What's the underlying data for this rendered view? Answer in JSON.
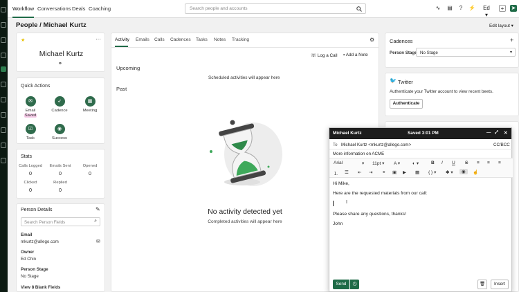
{
  "topnav": {
    "items": [
      "Workflow",
      "Conversations",
      "Deals",
      "Coaching"
    ],
    "search_placeholder": "Search people and accounts",
    "user": "Ed"
  },
  "page": {
    "breadcrumb_root": "People",
    "breadcrumb_sep": "/",
    "breadcrumb_current": "Michael Kurtz",
    "edit_layout": "Edit layout"
  },
  "profile": {
    "name": "Michael Kurtz"
  },
  "quick_actions": {
    "title": "Quick Actions",
    "items": [
      {
        "label": "Email",
        "badge": "Saved"
      },
      {
        "label": "Cadence"
      },
      {
        "label": "Meeting"
      },
      {
        "label": "Task"
      },
      {
        "label": "Success"
      }
    ]
  },
  "stats": {
    "title": "Stats",
    "items": [
      {
        "label": "Calls Logged",
        "value": "0"
      },
      {
        "label": "Emails Sent",
        "value": "0"
      },
      {
        "label": "Opened",
        "value": "0"
      },
      {
        "label": "Clicked",
        "value": "0"
      },
      {
        "label": "Replied",
        "value": "0"
      }
    ]
  },
  "person_details": {
    "title": "Person Details",
    "search_placeholder": "Search Person Fields",
    "email_label": "Email",
    "email": "mkurtz@allego.com",
    "owner_label": "Owner",
    "owner": "Ed Chin",
    "stage_label": "Person Stage",
    "stage": "No Stage",
    "blank_fields": "View 8 Blank Fields"
  },
  "activity": {
    "tabs": [
      "Activity",
      "Emails",
      "Calls",
      "Cadences",
      "Tasks",
      "Notes",
      "Tracking"
    ],
    "log_call": "Log a Call",
    "add_note": "Add a Note",
    "upcoming": "Upcoming",
    "upcoming_empty": "Scheduled activities will appear here",
    "past": "Past",
    "empty_title": "No activity detected yet",
    "empty_sub": "Completed activities will appear here"
  },
  "cadences": {
    "title": "Cadences",
    "stage_label": "Person Stage",
    "stage_value": "No Stage"
  },
  "twitter": {
    "title": "Twitter",
    "desc": "Authenticate your Twitter account to view recent beets.",
    "button": "Authenticate"
  },
  "composer": {
    "title": "Michael Kurtz",
    "saved": "Saved 3:01 PM",
    "to_label": "To",
    "to": "Michael Kurtz <mkurtz@allego.com>",
    "cc": "CC/BCC",
    "subject": "More information on ACME",
    "font": "Arial",
    "size": "11pt",
    "body": [
      "Hi Mike,",
      "Here are the requested materials from our call:",
      "Please share any questions, thanks!",
      "John"
    ],
    "send": "Send",
    "insert": "Insert"
  },
  "colors": {
    "brand": "#1f6b47",
    "dark": "#1d1d1d",
    "badge": "#f4c9e6"
  }
}
